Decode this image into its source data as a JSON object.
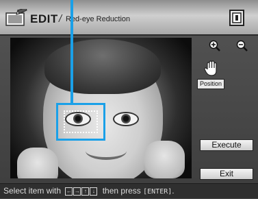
{
  "header": {
    "title": "EDIT",
    "separator": "/",
    "subtitle": "Red-eye Reduction",
    "edit_icon": "pencil-photo-icon",
    "memory_icon": "memory-card-icon"
  },
  "preview": {
    "image": "child-face-photo"
  },
  "controls": {
    "zoom_in_icon": "zoom-in-icon",
    "zoom_out_icon": "zoom-out-icon",
    "hand_icon": "hand-move-icon",
    "position_label": "Position",
    "execute_label": "Execute",
    "exit_label": "Exit"
  },
  "footer": {
    "prefix": "Select item with",
    "arrow_keys": [
      "←",
      "→",
      "↑",
      "↓"
    ],
    "middle": "then press",
    "enter_key": "[ENTER]",
    "suffix": "."
  },
  "colors": {
    "selection": "#1aa0e8",
    "header_bg": "#cfcfcf",
    "footer_bg": "#2f2f2f"
  }
}
